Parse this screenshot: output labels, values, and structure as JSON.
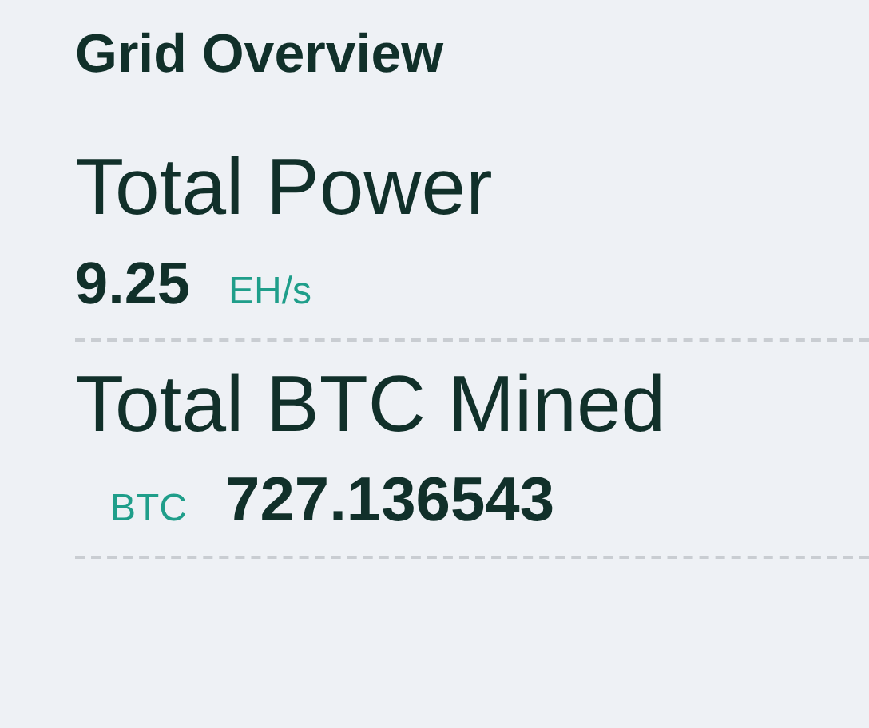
{
  "title": "Grid Overview",
  "stats": [
    {
      "label": "Total Power",
      "value": "9.25",
      "unit": "EH/s",
      "kind": "unit-after"
    },
    {
      "label": "Total BTC Mined",
      "value": "727.136543",
      "unit": "BTC",
      "kind": "unit-before"
    }
  ]
}
